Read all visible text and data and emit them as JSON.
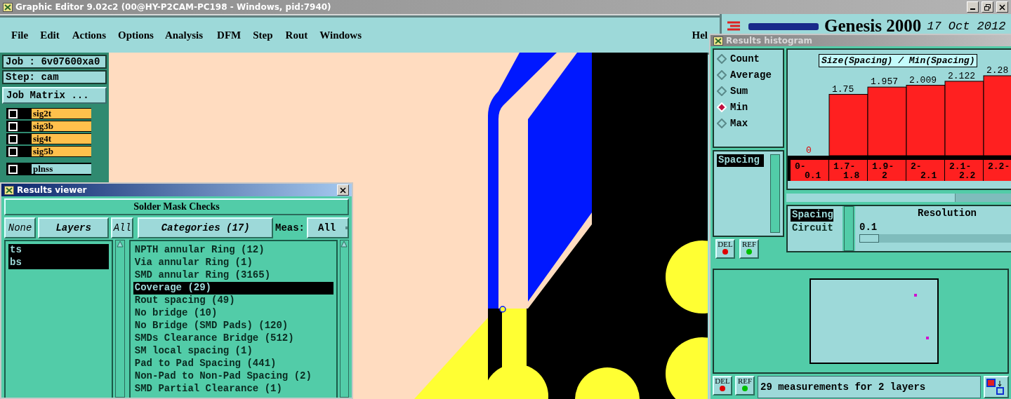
{
  "window": {
    "title": "Graphic Editor 9.02c2 (00@HY-P2CAM-PC198 - Windows, pid:7940)"
  },
  "menu": [
    "File",
    "Edit",
    "Actions",
    "Options",
    "Analysis",
    "DFM",
    "Step",
    "Rout",
    "Windows",
    "Hel"
  ],
  "branding": {
    "product": "Genesis 2000",
    "date": "17 Oct 2012"
  },
  "job_panel": {
    "job": "Job : 6v07600xa0",
    "step": "Step: cam",
    "matrix_button": "Job Matrix ...",
    "layers": [
      {
        "name": "sig2t",
        "color": "#ffc04c",
        "checked": false
      },
      {
        "name": "sig3b",
        "color": "#ffc04c",
        "checked": false
      },
      {
        "name": "sig4t",
        "color": "#ffc04c",
        "checked": false
      },
      {
        "name": "sig5b",
        "color": "#ffc04c",
        "checked": false
      },
      {
        "name": "plnss",
        "color": "#9ddada",
        "checked": false
      }
    ]
  },
  "results_viewer": {
    "title": "Results viewer",
    "group": "Solder Mask Checks",
    "layer_buttons": [
      "None",
      "Layers",
      "All"
    ],
    "layers": [
      {
        "name": "ts",
        "selected": true
      },
      {
        "name": "bs",
        "selected": true
      }
    ],
    "categories_button": "Categories (17)",
    "meas_label": "Meas:",
    "meas_value": "All",
    "categories": [
      {
        "label": "NPTH annular Ring (12)",
        "selected": false
      },
      {
        "label": "Via annular Ring (1)",
        "selected": false
      },
      {
        "label": "SMD annular Ring (3165)",
        "selected": false
      },
      {
        "label": "Coverage (29)",
        "selected": true
      },
      {
        "label": "Rout spacing (49)",
        "selected": false
      },
      {
        "label": "No bridge (10)",
        "selected": false
      },
      {
        "label": "No Bridge (SMD Pads) (120)",
        "selected": false
      },
      {
        "label": "SMDs Clearance Bridge (512)",
        "selected": false
      },
      {
        "label": "SM local spacing (1)",
        "selected": false
      },
      {
        "label": "Pad to Pad Spacing (441)",
        "selected": false
      },
      {
        "label": "Non-Pad to Non-Pad Spacing (2)",
        "selected": false
      },
      {
        "label": "SMD Partial Clearance (1)",
        "selected": false
      }
    ]
  },
  "histogram": {
    "title": "Results histogram",
    "modes": [
      {
        "label": "Count",
        "selected": false
      },
      {
        "label": "Average",
        "selected": false
      },
      {
        "label": "Sum",
        "selected": false
      },
      {
        "label": "Min",
        "selected": true
      },
      {
        "label": "Max",
        "selected": false
      }
    ],
    "attributes": [
      {
        "label": "Spacing",
        "selected": true
      }
    ],
    "attribute_buttons": [
      "DEL",
      "REF"
    ],
    "chart_title": "Size(Spacing) / Min(Spacing)",
    "chart_data": {
      "type": "bar",
      "categories": [
        "0- 0.1",
        "1.7- 1.8",
        "1.9- 2",
        "2- 2.1",
        "2.1- 2.2",
        "2.2-"
      ],
      "values": [
        0,
        1.75,
        1.957,
        2.009,
        2.122,
        2.28
      ],
      "data_labels": true
    },
    "measures": [
      {
        "label": "Spacing",
        "selected": true
      },
      {
        "label": "Circuit",
        "selected": false
      }
    ],
    "resolution_label": "Resolution",
    "resolution_value": "0.1",
    "resolution": {
      "level": 0.05
    },
    "status_buttons": [
      "DEL",
      "REF"
    ],
    "status": "29 measurements for 2 layers"
  }
}
